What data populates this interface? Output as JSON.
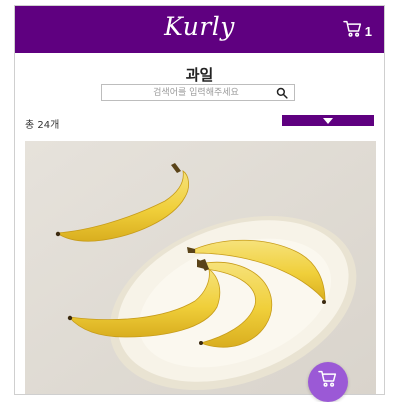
{
  "header": {
    "logo_text": "Kurly",
    "cart_count": "1",
    "brand_color": "#5f0080"
  },
  "page": {
    "title": "과일"
  },
  "search": {
    "placeholder": "검색어를 입력해주세요"
  },
  "list": {
    "count_label": "총 24개"
  },
  "product": {
    "image_icon": "banana-photo"
  },
  "fab": {
    "icon": "cart-icon",
    "color": "#9b59d6"
  }
}
